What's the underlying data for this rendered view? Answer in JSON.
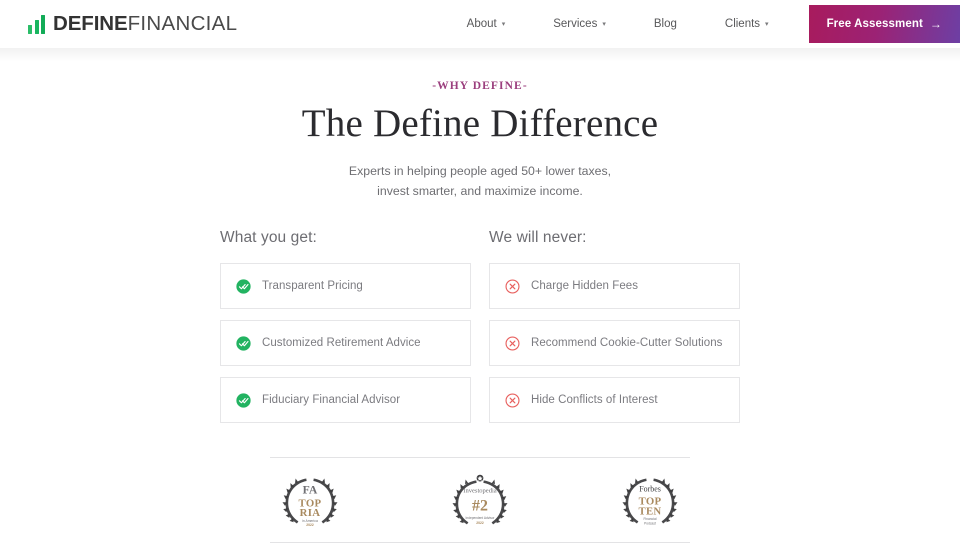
{
  "header": {
    "brand": {
      "bold": "DEFINE",
      "light": "FINANCIAL",
      "logo_icon": "bar-chart-icon"
    },
    "nav": [
      {
        "label": "About",
        "caret": "▾",
        "has_dropdown": true
      },
      {
        "label": "Services",
        "caret": "▾",
        "has_dropdown": true
      },
      {
        "label": "Blog",
        "caret": "",
        "has_dropdown": false
      },
      {
        "label": "Clients",
        "caret": "▾",
        "has_dropdown": true
      }
    ],
    "cta": {
      "label": "Free Assessment",
      "arrow": "→",
      "gradient_from": "#a81b5d",
      "gradient_to": "#6d3fa4"
    }
  },
  "hero": {
    "eyebrow": "-WHY DEFINE-",
    "eyebrow_color": "#9b3f7e",
    "title": "The Define Difference",
    "subtitle_line1": "Experts in helping people aged 50+ lower taxes,",
    "subtitle_line2": "invest smarter, and maximize income."
  },
  "columns": [
    {
      "title": "What you get:",
      "icon": "check-circle-icon",
      "icon_color": "#22b361",
      "items": [
        {
          "label": "Transparent Pricing"
        },
        {
          "label": "Customized Retirement Advice"
        },
        {
          "label": "Fiduciary Financial Advisor"
        }
      ]
    },
    {
      "title": "We will never:",
      "icon": "x-circle-icon",
      "icon_color": "#e8615f",
      "items": [
        {
          "label": "Charge Hidden Fees"
        },
        {
          "label": "Recommend Cookie-Cutter Solutions"
        },
        {
          "label": "Hide Conflicts of Interest"
        }
      ]
    }
  ],
  "badges": [
    {
      "name": "fa-top-ria-badge",
      "brand": "FA",
      "line1": "TOP",
      "line2": "RIA",
      "sub": "in America",
      "year": "2022"
    },
    {
      "name": "investopedia-badge",
      "brand": "Investopedia",
      "line1": "#2",
      "line2": "",
      "sub": "Independent Advisor",
      "year": "2022"
    },
    {
      "name": "forbes-top-ten-badge",
      "brand": "Forbes",
      "line1": "TOP",
      "line2": "TEN",
      "sub": "Financial",
      "year": "Podcast"
    }
  ]
}
